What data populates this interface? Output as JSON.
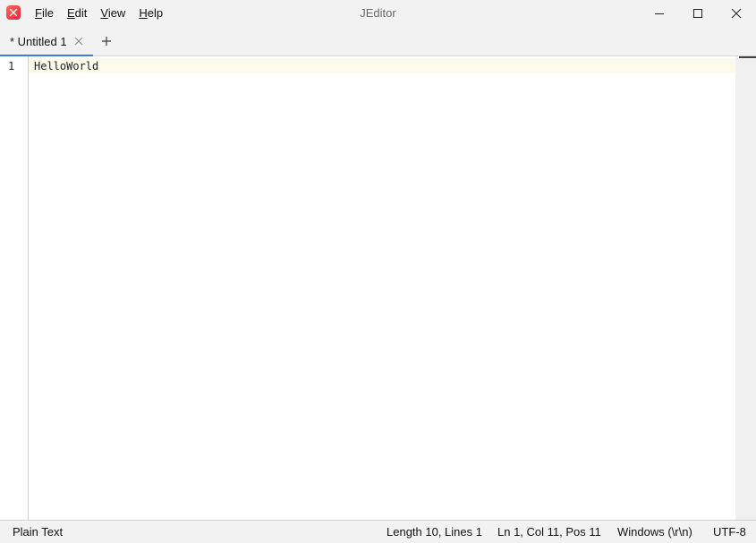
{
  "app": {
    "title": "JEditor",
    "icon": "app-logo-icon",
    "accent_color": "#3c7fd0",
    "logo_color": "#e8233c"
  },
  "menu": {
    "items": [
      {
        "mnemonic": "F",
        "rest": "ile"
      },
      {
        "mnemonic": "E",
        "rest": "dit"
      },
      {
        "mnemonic": "V",
        "rest": "iew"
      },
      {
        "mnemonic": "H",
        "rest": "elp"
      }
    ]
  },
  "window_controls": {
    "minimize_icon": "minimize-icon",
    "maximize_icon": "maximize-icon",
    "close_icon": "close-icon"
  },
  "tabs": [
    {
      "label": "* Untitled 1",
      "active": true,
      "modified": true
    }
  ],
  "tab_bar": {
    "add_icon": "plus-icon",
    "close_icon": "close-icon"
  },
  "editor": {
    "lines": [
      {
        "number": "1",
        "text": "HelloWorld"
      }
    ],
    "current_line_color": "#fdfaec"
  },
  "status": {
    "language": "Plain Text",
    "length": "Length 10, Lines 1",
    "position": "Ln 1, Col 11, Pos 11",
    "line_ending": "Windows (\\r\\n)",
    "encoding": "UTF-8"
  }
}
